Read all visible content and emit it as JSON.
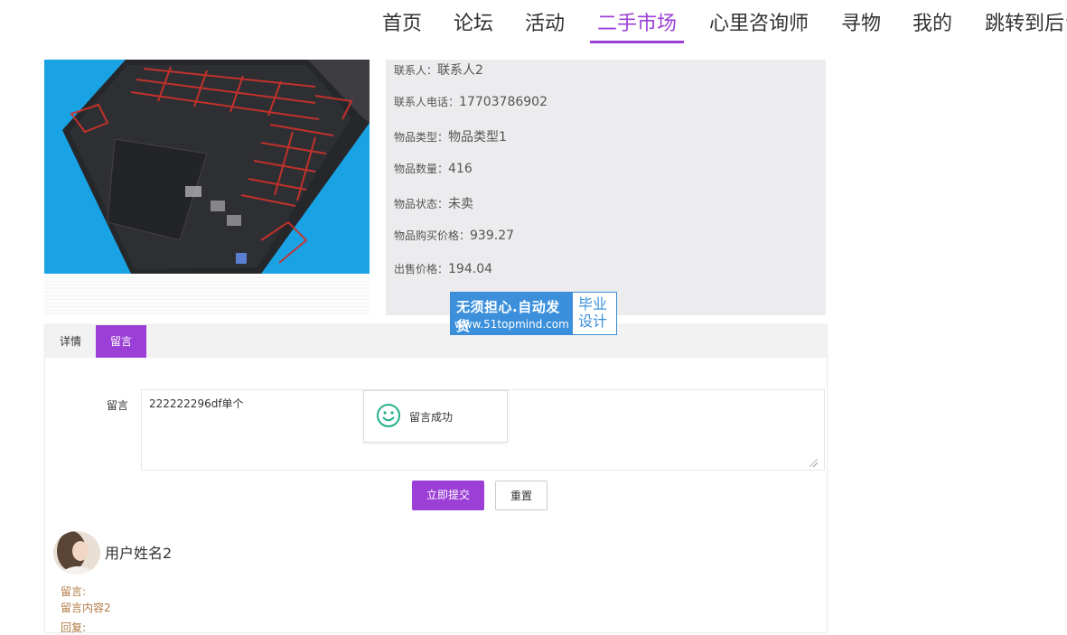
{
  "nav": {
    "items": [
      "首页",
      "论坛",
      "活动",
      "二手市场",
      "心里咨询师",
      "寻物",
      "我的",
      "跳转到后台"
    ],
    "active": "二手市场"
  },
  "product": {
    "contact_label": "联系人：",
    "contact_value": "联系人2",
    "phone_label": "联系人电话：",
    "phone_value": "17703786902",
    "type_label": "物品类型：",
    "type_value": "物品类型1",
    "qty_label": "物品数量：",
    "qty_value": "416",
    "status_label": "物品状态：",
    "status_value": "未卖",
    "buy_price_label": "物品购买价格：",
    "buy_price_value": "939.27",
    "sell_price_label": "出售价格：",
    "sell_price_value": "194.04"
  },
  "watermark": {
    "line1": "无须担心.自动发货",
    "line2": "www.51topmind.com",
    "right_top": "毕业",
    "right_bottom": "设计"
  },
  "tabs": [
    "详情",
    "留言"
  ],
  "active_tab": "留言",
  "form": {
    "label": "留言",
    "value": "222222296df单个",
    "submit_label": "立即提交",
    "reset_label": "重置"
  },
  "toast": {
    "text": "留言成功"
  },
  "comments": [
    {
      "user": "用户姓名2",
      "label": "留言:",
      "content": "留言内容2",
      "reply_label": "回复:"
    }
  ],
  "colors": {
    "accent": "#9b3fd6",
    "toast_icon": "#25b08a",
    "comment_text": "#b07a45"
  }
}
